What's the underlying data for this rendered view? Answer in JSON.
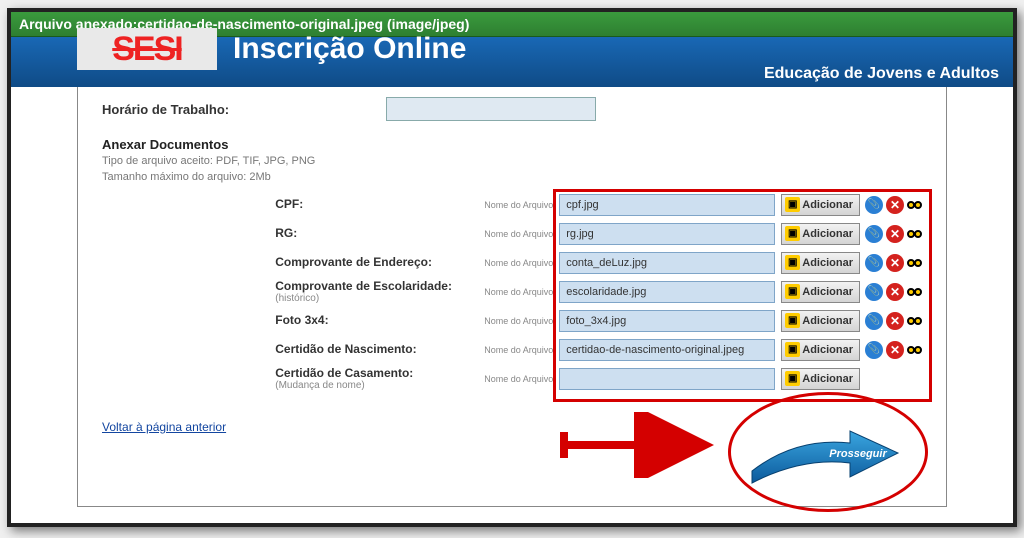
{
  "notification": "Arquivo anexado:certidao-de-nascimento-original.jpeg (image/jpeg)",
  "logo": "SESI",
  "page_title": "Inscrição Online",
  "subtitle": "Educação de Jovens e Adultos",
  "horario_label": "Horário de Trabalho:",
  "section": {
    "heading": "Anexar Documentos",
    "accepted": "Tipo de arquivo aceito: PDF, TIF, JPG, PNG",
    "maxsize": "Tamanho máximo do arquivo: 2Mb"
  },
  "file_label": "Nome do Arquivo",
  "btn_add": "Adicionar",
  "docs": [
    {
      "label": "CPF:",
      "sub": "",
      "value": "cpf.jpg",
      "has_actions": true
    },
    {
      "label": "RG:",
      "sub": "",
      "value": "rg.jpg",
      "has_actions": true
    },
    {
      "label": "Comprovante de Endereço:",
      "sub": "",
      "value": "conta_deLuz.jpg",
      "has_actions": true
    },
    {
      "label": "Comprovante de Escolaridade:",
      "sub": "(histórico)",
      "value": "escolaridade.jpg",
      "has_actions": true
    },
    {
      "label": "Foto 3x4:",
      "sub": "",
      "value": "foto_3x4.jpg",
      "has_actions": true
    },
    {
      "label": "Certidão de Nascimento:",
      "sub": "",
      "value": "certidao-de-nascimento-original.jpeg",
      "has_actions": true
    },
    {
      "label": "Certidão de Casamento:",
      "sub": "(Mudança de nome)",
      "value": "",
      "has_actions": false
    }
  ],
  "back_link": "Voltar à página anterior",
  "prosseguir": "Prosseguir"
}
